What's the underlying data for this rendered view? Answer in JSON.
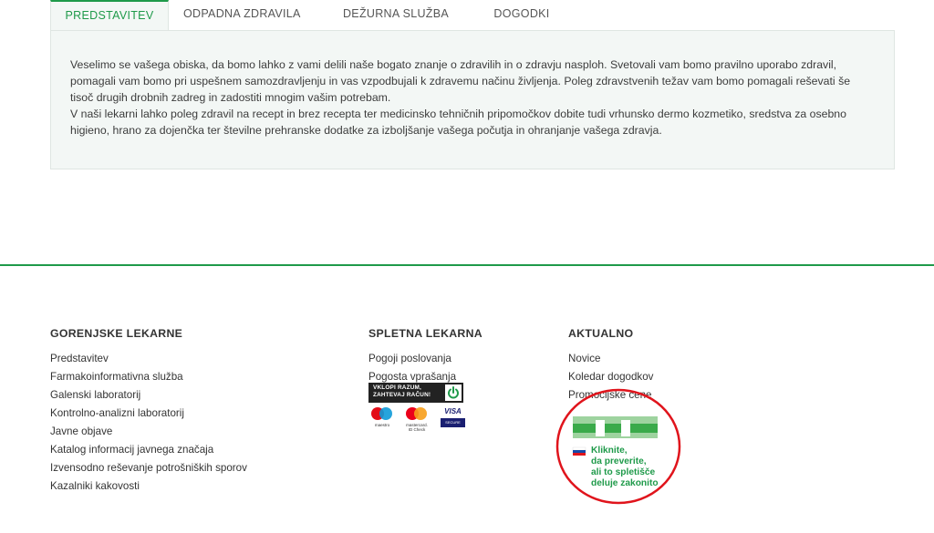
{
  "tabs": [
    {
      "label": "PREDSTAVITEV",
      "active": true
    },
    {
      "label": "ODPADNA ZDRAVILA",
      "active": false
    },
    {
      "label": "DEŽURNA SLUŽBA",
      "active": false
    },
    {
      "label": "DOGODKI",
      "active": false
    }
  ],
  "panel": {
    "text": "Veselimo se vašega obiska, da bomo lahko z vami delili naše bogato znanje o zdravilih in o zdravju nasploh. Svetovali vam bomo pravilno uporabo zdravil, pomagali vam bomo pri uspešnem samozdravljenju in vas vzpodbujali k zdravemu načinu življenja. Poleg zdravstvenih težav vam bomo pomagali reševati še tisoč drugih drobnih zadreg in zadostiti mnogim vašim potrebam.",
    "text2": "V naši lekarni lahko poleg zdravil na recept in brez recepta ter medicinsko tehničnih pripomočkov dobite tudi vrhunsko dermo kozmetiko, sredstva za osebno higieno, hrano za dojenčka ter številne prehranske dodatke za izboljšanje vašega počutja in ohranjanje vašega zdravja."
  },
  "footer": {
    "col1": {
      "heading": "GORENJSKE LEKARNE",
      "links": [
        "Predstavitev",
        "Farmakoinformativna služba",
        "Galenski laboratorij",
        "Kontrolno-analizni laboratorij",
        "Javne objave",
        "Katalog informacij javnega značaja",
        "Izvensodno reševanje potrošniških sporov",
        "Kazalniki kakovosti"
      ]
    },
    "col2": {
      "heading": "SPLETNA LEKARNA",
      "links": [
        "Pogoji poslovanja",
        "Pogosta vprašanja"
      ],
      "vklopi_line1": "VKLOPI RAZUM,",
      "vklopi_line2": "ZAHTEVAJ RAČUN!",
      "maestro_label": "maestro",
      "mastercard_label_1": "mastercard.",
      "mastercard_label_2": "ID Check",
      "visa_label": "VISA",
      "visa_secure": "SECURE"
    },
    "col3": {
      "heading": "AKTUALNO",
      "links": [
        "Novice",
        "Koledar dogodkov",
        "Promocijske cene"
      ],
      "badge_line1": "Kliknite,",
      "badge_line2": "da preverite,",
      "badge_line3": "ali to spletišče",
      "badge_line4": "deluje zakonito"
    }
  },
  "colors": {
    "accent": "#1f9a4a",
    "panel_bg": "#f3f7f5",
    "badge_circle": "#e0141c"
  }
}
